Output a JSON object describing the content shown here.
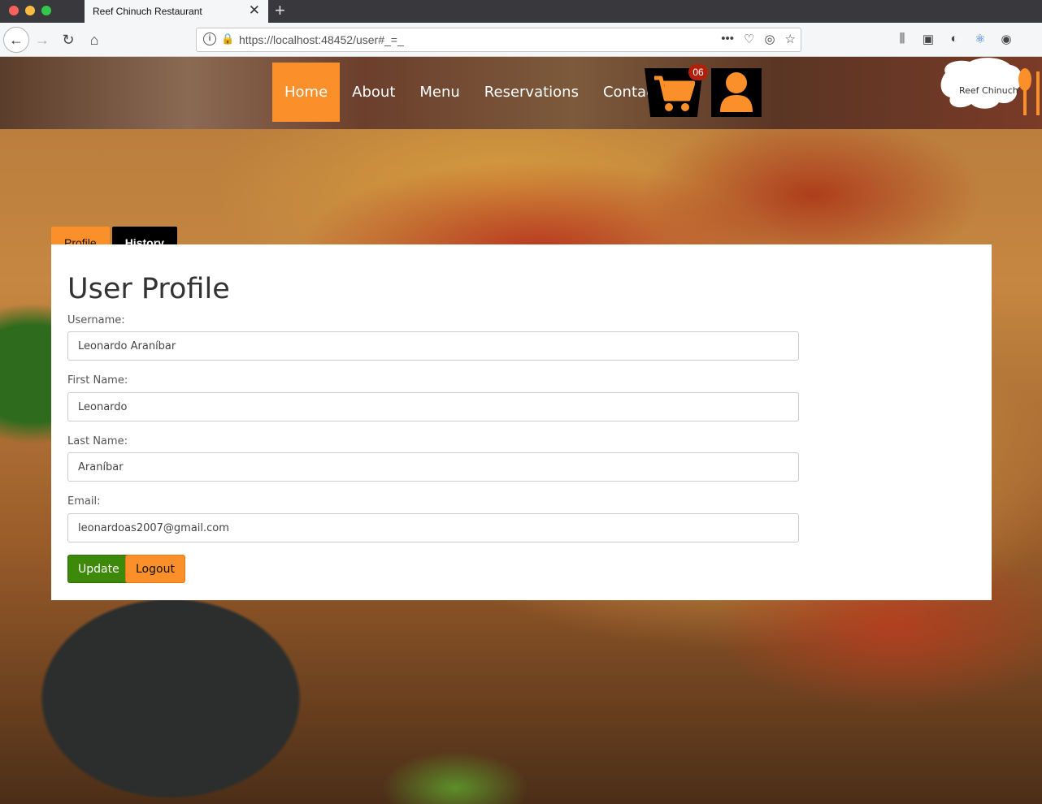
{
  "browser": {
    "tab_title": "Reef Chinuch Restaurant",
    "url": "https://localhost:48452/user#_=_",
    "icons": [
      "back-icon",
      "forward-icon",
      "reload-icon",
      "home-icon",
      "info-icon",
      "lock-warning-icon",
      "more-icon",
      "pocket-icon",
      "extension-icon",
      "star-icon",
      "library-icon",
      "sidebar-icon",
      "moon-icon",
      "react-icon",
      "account-icon"
    ]
  },
  "nav": {
    "items": [
      {
        "label": "Home",
        "active": true
      },
      {
        "label": "About"
      },
      {
        "label": "Menu"
      },
      {
        "label": "Reservations"
      },
      {
        "label": "Contact"
      }
    ],
    "cart_count": "06",
    "logo_text": "Reef Chinuch"
  },
  "profile": {
    "tabs": [
      "Profile",
      "History"
    ],
    "title": "User Profile",
    "fields": [
      {
        "label": "Username:",
        "value": "Leonardo Araníbar"
      },
      {
        "label": "First Name:",
        "value": "Leonardo"
      },
      {
        "label": "Last Name:",
        "value": "Araníbar"
      },
      {
        "label": "Email:",
        "value": "leonardoas2007@gmail.com"
      }
    ],
    "update_label": "Update",
    "logout_label": "Logout"
  },
  "colors": {
    "accent": "#fb8f2a",
    "update_button": "#3d8a0b",
    "badge": "#b0200b"
  }
}
